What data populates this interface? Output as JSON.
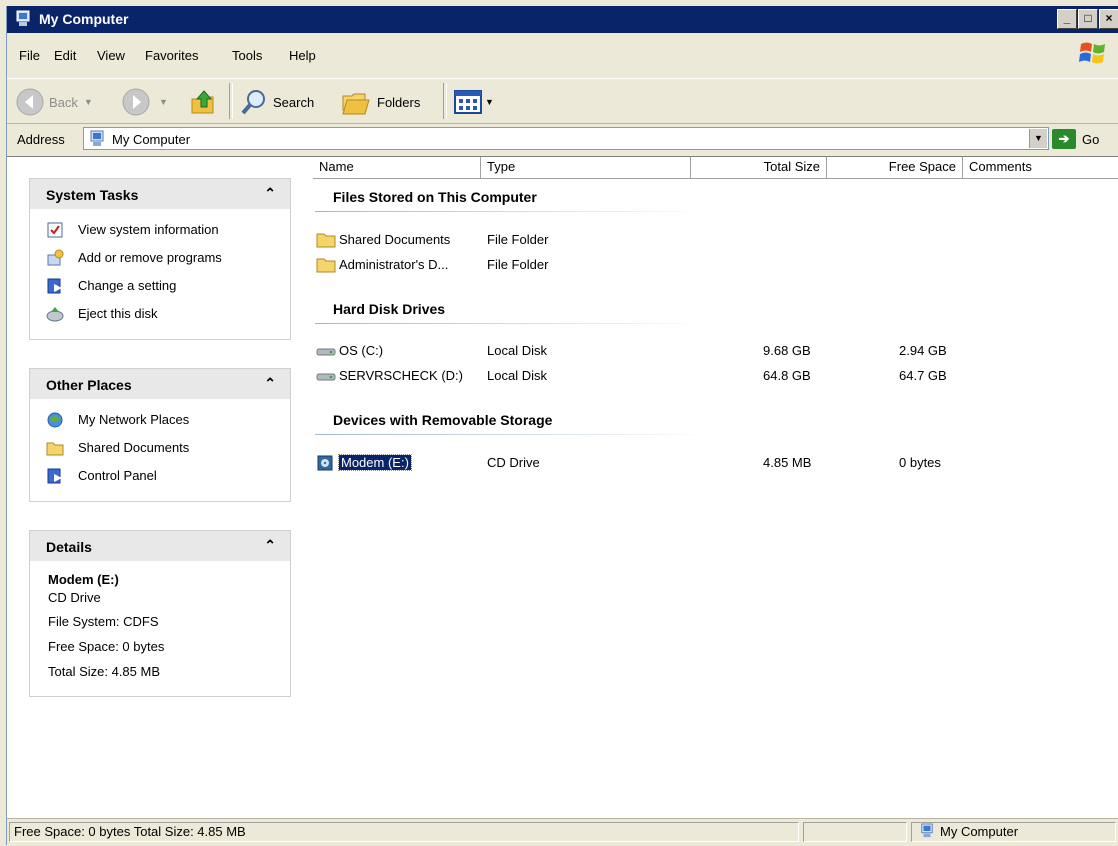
{
  "window": {
    "title": "My Computer"
  },
  "menu": [
    "File",
    "Edit",
    "View",
    "Favorites",
    "Tools",
    "Help"
  ],
  "toolbar": {
    "back": "Back",
    "search": "Search",
    "folders": "Folders"
  },
  "address": {
    "label": "Address",
    "value": "My Computer",
    "go": "Go"
  },
  "system_tasks": {
    "title": "System Tasks",
    "items": [
      "View system information",
      "Add or remove programs",
      "Change a setting",
      "Eject this disk"
    ]
  },
  "other_places": {
    "title": "Other Places",
    "items": [
      "My Network Places",
      "Shared Documents",
      "Control Panel"
    ]
  },
  "details": {
    "title": "Details",
    "name": "Modem (E:)",
    "type": "CD Drive",
    "file_system": "File System: CDFS",
    "free_space": "Free Space: 0 bytes",
    "total_size": "Total Size: 4.85 MB"
  },
  "columns": [
    "Name",
    "Type",
    "Total Size",
    "Free Space",
    "Comments"
  ],
  "groups": [
    {
      "title": "Files Stored on This Computer",
      "rows": [
        {
          "name": "Shared Documents",
          "type": "File Folder",
          "total": "",
          "free": ""
        },
        {
          "name": "Administrator's D...",
          "type": "File Folder",
          "total": "",
          "free": ""
        }
      ]
    },
    {
      "title": "Hard Disk Drives",
      "rows": [
        {
          "name": "OS (C:)",
          "type": "Local Disk",
          "total": "9.68 GB",
          "free": "2.94 GB"
        },
        {
          "name": "SERVRSCHECK (D:)",
          "type": "Local Disk",
          "total": "64.8 GB",
          "free": "64.7 GB"
        }
      ]
    },
    {
      "title": "Devices with Removable Storage",
      "rows": [
        {
          "name": "Modem (E:)",
          "type": "CD Drive",
          "total": "4.85 MB",
          "free": "0 bytes"
        }
      ]
    }
  ],
  "status": {
    "left": "Free Space: 0 bytes Total Size: 4.85 MB",
    "right": "My Computer"
  }
}
